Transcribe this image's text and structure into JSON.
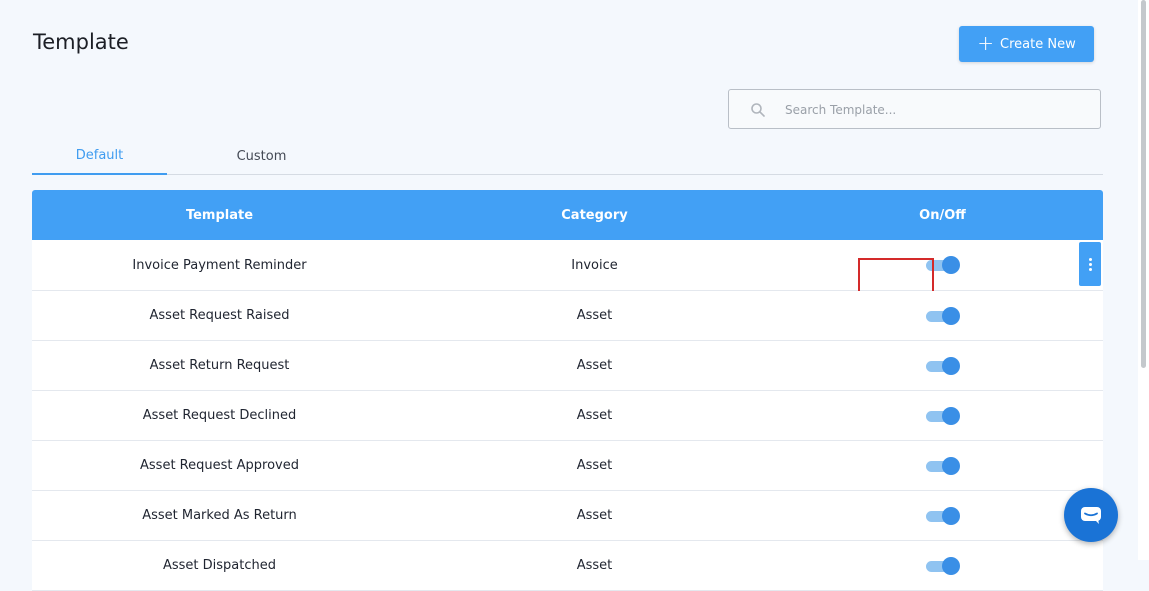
{
  "page": {
    "title": "Template"
  },
  "toolbar": {
    "create_label": "Create New"
  },
  "search": {
    "placeholder": "Search Template..."
  },
  "tabs": [
    {
      "label": "Default",
      "active": true
    },
    {
      "label": "Custom",
      "active": false
    }
  ],
  "table": {
    "headers": [
      "Template",
      "Category",
      "On/Off"
    ],
    "rows": [
      {
        "template": "Invoice Payment Reminder",
        "category": "Invoice",
        "on": true
      },
      {
        "template": "Asset Request Raised",
        "category": "Asset",
        "on": true
      },
      {
        "template": "Asset Return Request",
        "category": "Asset",
        "on": true
      },
      {
        "template": "Asset Request Declined",
        "category": "Asset",
        "on": true
      },
      {
        "template": "Asset Request Approved",
        "category": "Asset",
        "on": true
      },
      {
        "template": "Asset Marked As Return",
        "category": "Asset",
        "on": true
      },
      {
        "template": "Asset Dispatched",
        "category": "Asset",
        "on": true
      }
    ]
  },
  "colors": {
    "accent": "#42a0f5",
    "highlight": "#d42a2a",
    "chat": "#1a73d6"
  }
}
